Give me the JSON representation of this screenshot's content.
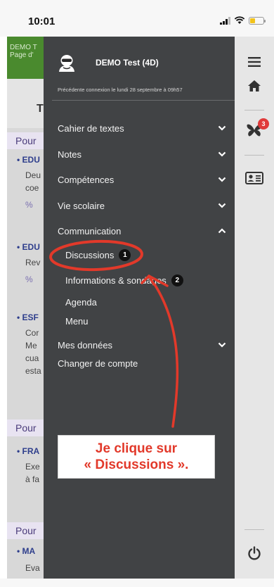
{
  "status_bar": {
    "time": "10:01"
  },
  "background": {
    "header_line1": "DEMO T",
    "header_line2": "Page d'",
    "letter": "T",
    "sections": [
      "Pour",
      "Pour",
      "Pour"
    ],
    "entries": [
      {
        "title": "EDU",
        "lines": [
          "Deu",
          "coe"
        ]
      },
      {
        "title": "EDU",
        "lines": [
          "Rev"
        ]
      },
      {
        "title": "ESF",
        "lines": [
          "Cor",
          "Me",
          "cua",
          "esta"
        ]
      },
      {
        "title": "FRA",
        "lines": [
          "Exe",
          "à fa"
        ]
      },
      {
        "title": "MA",
        "lines": [
          "Eva"
        ]
      }
    ],
    "link_glyph": "%"
  },
  "drawer": {
    "user_name": "DEMO Test (4D)",
    "last_connection": "Précédente connexion le lundi 28 septembre à 09h57",
    "menu": [
      {
        "label": "Cahier de textes",
        "chevron": "down"
      },
      {
        "label": "Notes",
        "chevron": "down"
      },
      {
        "label": "Compétences",
        "chevron": "down"
      },
      {
        "label": "Vie scolaire",
        "chevron": "down"
      },
      {
        "label": "Communication",
        "chevron": "up"
      }
    ],
    "sub_items": [
      {
        "label": "Discussions",
        "badge": "1"
      },
      {
        "label": "Informations & sondages",
        "badge": "2"
      },
      {
        "label": "Agenda"
      },
      {
        "label": "Menu"
      }
    ],
    "after_menu": [
      {
        "label": "Mes données",
        "chevron": "down"
      },
      {
        "label": "Changer de compte"
      }
    ]
  },
  "rail": {
    "icons": [
      "hamburger-menu-icon",
      "home-icon",
      "butterfly-icon",
      "id-card-icon",
      "power-icon"
    ],
    "notification_count": "3"
  },
  "annotation": {
    "line1": "Je clique sur",
    "line2": "« Discussions ».",
    "color": "#e2392a"
  }
}
